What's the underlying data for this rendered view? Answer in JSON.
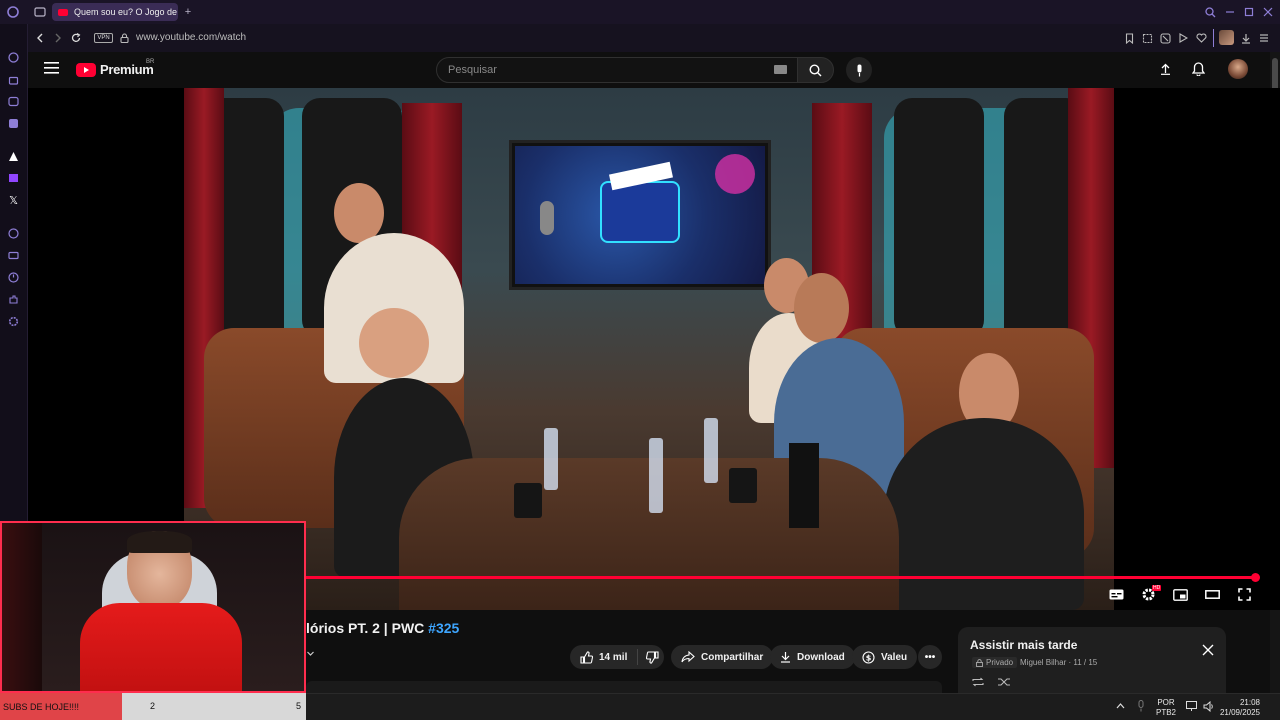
{
  "browser": {
    "tab_title": "Quem sou eu? O Jogo de",
    "url": "www.youtube.com/watch",
    "vpn_label": "VPN"
  },
  "youtube": {
    "logo_text": "Premium",
    "logo_region": "BR",
    "search_placeholder": "Pesquisar"
  },
  "video": {
    "title_text": "lórios PT. 2 | PWC ",
    "title_tag": "#325",
    "progress_fraction": 0.995,
    "settings_badge": "HD"
  },
  "actions": {
    "like_count": "14 mil",
    "share_label": "Compartilhar",
    "download_label": "Download",
    "thanks_label": "Valeu"
  },
  "watch_later": {
    "title": "Assistir mais tarde",
    "privacy": "Privado",
    "owner_progress": "Miguel Bilhar · 11 / 15"
  },
  "overlay": {
    "subs_label": "SUBS DE HOJE!!!!",
    "subs_current": "2",
    "subs_goal": "5"
  },
  "taskbar": {
    "lang_top": "POR",
    "lang_bottom": "PTB2",
    "time": "21:08",
    "date": "21/09/2025"
  },
  "colors": {
    "accent_red": "#ff0033",
    "link_blue": "#3ea6ff",
    "browser_purple": "#8e7ed6"
  }
}
